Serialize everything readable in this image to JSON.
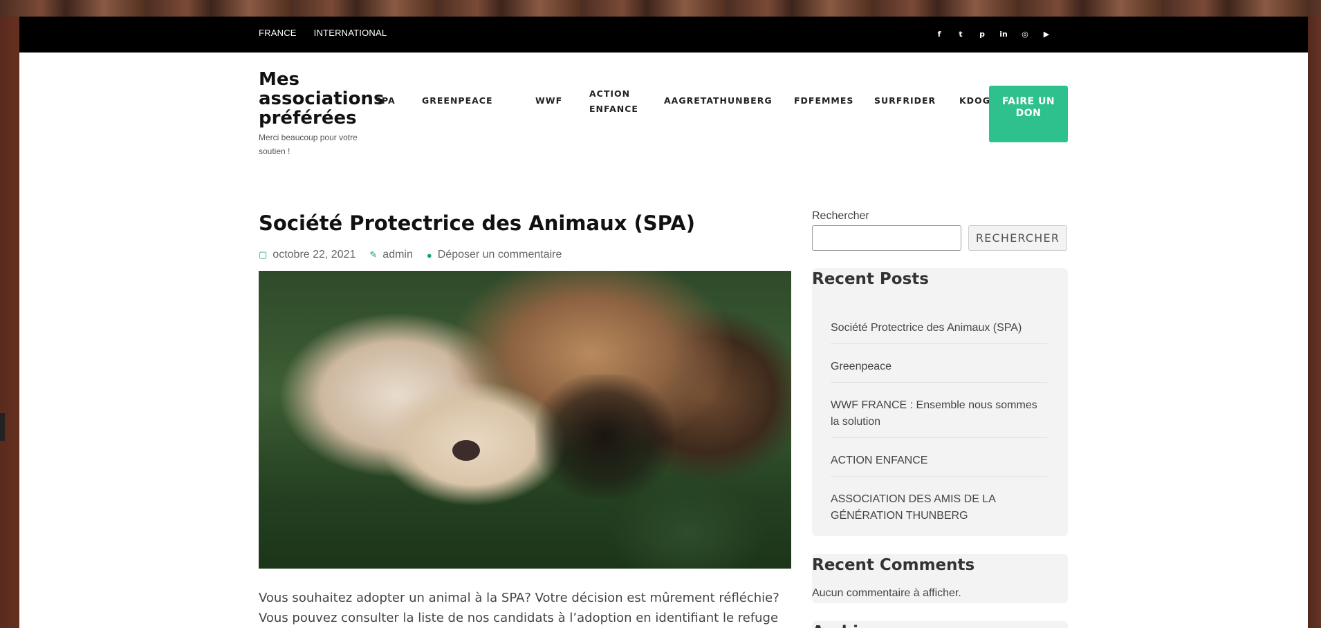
{
  "topbar": {
    "links": [
      "FRANCE",
      "INTERNATIONAL"
    ],
    "social_icons": [
      "facebook-icon",
      "twitter-icon",
      "pinterest-icon",
      "linkedin-icon",
      "instagram-icon",
      "youtube-icon"
    ],
    "social_glyphs": [
      "f",
      "t",
      "p",
      "in",
      "◎",
      "▶"
    ]
  },
  "brand": {
    "title": "Mes associations préférées",
    "tagline": "Merci beaucoup pour votre soutien !"
  },
  "nav": {
    "items": [
      "SPA",
      "GREENPEACE",
      "WWF",
      "ACTION ENFANCE",
      "AAGRETATHUNBERG",
      "FDFEMMES",
      "SURFRIDER",
      "KDOG"
    ],
    "donate_label": "FAIRE UN DON"
  },
  "post": {
    "title": "Société Protectrice des Animaux (SPA)",
    "date": "octobre 22, 2021",
    "author": "admin",
    "comment_link": "Déposer un commentaire",
    "body": "Vous souhaitez adopter un animal à la SPA? Votre décision est mûrement réfléchie? Vous pouvez consulter la liste de nos candidats à l’adoption en identifiant le refuge le plus proche"
  },
  "sidebar": {
    "search_label": "Rechercher",
    "search_button": "RECHERCHER",
    "recent_posts_title": "Recent Posts",
    "recent_posts": [
      "Société Protectrice des Animaux (SPA)",
      "Greenpeace",
      "WWF FRANCE : Ensemble nous sommes la solution",
      "ACTION ENFANCE",
      "ASSOCIATION DES AMIS DE LA GÉNÉRATION THUNBERG"
    ],
    "recent_comments_title": "Recent Comments",
    "no_comments": "Aucun commentaire à afficher.",
    "archives_title": "Archives"
  },
  "colors": {
    "accent": "#2ec08d",
    "meta_icon": "#15a07a",
    "topbar_bg": "#000000"
  }
}
